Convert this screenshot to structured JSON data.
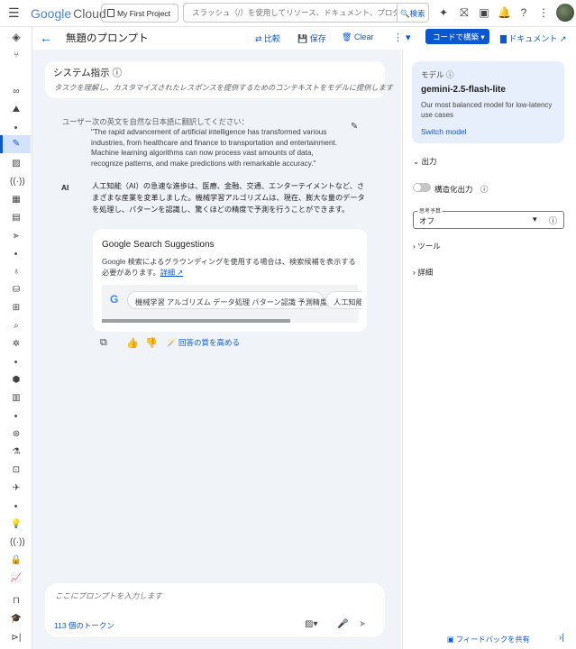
{
  "topbar": {
    "logo_google": "Google",
    "logo_cloud": "Cloud",
    "project": "My First Project",
    "search_placeholder": "スラッシュ（/）を使用してリソース、ドキュメント、プロダクトなど",
    "search_button": "検索"
  },
  "header": {
    "title": "無題のプロンプト",
    "compare": "比較",
    "save": "保存",
    "clear": "Clear",
    "code_button": "コードで構築",
    "docs": "ドキュメント"
  },
  "system": {
    "title": "システム指示",
    "placeholder": "タスクを理解し、カスタマイズされたレスポンスを提供するためのコンテキストをモデルに提供します"
  },
  "conversation": {
    "user_label": "ユーザー",
    "user_prompt": "次の英文を自然な日本語に翻訳してください：",
    "user_quote": "\"The rapid advancement of artificial intelligence has transformed various industries, from healthcare and finance to transportation and entertainment. Machine learning algorithms can now process vast amounts of data, recognize patterns, and make predictions with remarkable accuracy.\"",
    "ai_label": "AI",
    "ai_response": "人工知能（AI）の急速な進歩は、医療、金融、交通、エンターテイメントなど、さまざまな産業を変革しました。機械学習アルゴリズムは、現在、膨大な量のデータを処理し、パターンを認識し、驚くほどの精度で予測を行うことができます。"
  },
  "search_suggestions": {
    "title": "Google Search Suggestions",
    "description": "Google 検索によるグラウンディングを使用する場合は、検索候補を表示する必要があります。",
    "link": "詳細",
    "chips": [
      "機械学習 アルゴリズム データ処理 パターン認識 予測精度",
      "人工知能"
    ]
  },
  "actions": {
    "improve": "回答の質を高める"
  },
  "prompt": {
    "placeholder": "ここにプロンプトを入力します",
    "tokens": "113 個のトークン"
  },
  "model": {
    "label": "モデル",
    "name": "gemini-2.5-flash-lite",
    "description": "Our most balanced model for low-latency use cases",
    "switch": "Switch model"
  },
  "settings": {
    "output": "出力",
    "structured_output": "構造化出力",
    "think_label": "思考予算",
    "think_value": "オフ",
    "tools": "ツール",
    "details": "詳細"
  },
  "footer": {
    "feedback": "フィードバックを共有"
  },
  "colors": {
    "accent": "#0b57d0",
    "canvas": "#f0f4f9",
    "model_card": "#e8effc"
  }
}
